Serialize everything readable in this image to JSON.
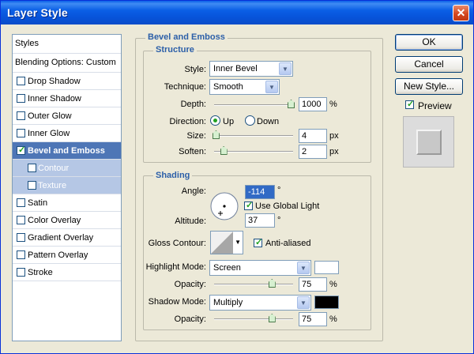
{
  "window": {
    "title": "Layer Style",
    "close_glyph": "✕"
  },
  "styles_list": {
    "header": "Styles",
    "blending": "Blending Options: Custom",
    "items": [
      {
        "label": "Drop Shadow",
        "checked": false
      },
      {
        "label": "Inner Shadow",
        "checked": false
      },
      {
        "label": "Outer Glow",
        "checked": false
      },
      {
        "label": "Inner Glow",
        "checked": false
      },
      {
        "label": "Bevel and Emboss",
        "checked": true,
        "selected": true
      },
      {
        "label": "Contour",
        "checked": false,
        "sub": true
      },
      {
        "label": "Texture",
        "checked": false,
        "sub": true
      },
      {
        "label": "Satin",
        "checked": false
      },
      {
        "label": "Color Overlay",
        "checked": false
      },
      {
        "label": "Gradient Overlay",
        "checked": false
      },
      {
        "label": "Pattern Overlay",
        "checked": false
      },
      {
        "label": "Stroke",
        "checked": false
      }
    ]
  },
  "bevel": {
    "section_title": "Bevel and Emboss",
    "structure_title": "Structure",
    "style_label": "Style:",
    "style_value": "Inner Bevel",
    "technique_label": "Technique:",
    "technique_value": "Smooth",
    "depth_label": "Depth:",
    "depth_value": "1000",
    "depth_unit": "%",
    "depth_level": 1.0,
    "direction_label": "Direction:",
    "direction_up": "Up",
    "direction_down": "Down",
    "direction_selected": "Up",
    "size_label": "Size:",
    "size_value": "4",
    "size_unit": "px",
    "size_level": 0.02,
    "soften_label": "Soften:",
    "soften_value": "2",
    "soften_unit": "px",
    "soften_level": 0.12
  },
  "shading": {
    "title": "Shading",
    "angle_label": "Angle:",
    "angle_value": "-114",
    "angle_unit": "°",
    "global_light_label": "Use Global Light",
    "global_light_checked": true,
    "altitude_label": "Altitude:",
    "altitude_value": "37",
    "altitude_unit": "°",
    "gloss_contour_label": "Gloss Contour:",
    "anti_aliased_label": "Anti-aliased",
    "anti_aliased_checked": true,
    "highlight_mode_label": "Highlight Mode:",
    "highlight_mode_value": "Screen",
    "highlight_color": "#ffffff",
    "highlight_opacity_label": "Opacity:",
    "highlight_opacity_value": "75",
    "highlight_opacity_unit": "%",
    "highlight_opacity_level": 0.75,
    "shadow_mode_label": "Shadow Mode:",
    "shadow_mode_value": "Multiply",
    "shadow_color": "#000000",
    "shadow_opacity_label": "Opacity:",
    "shadow_opacity_value": "75",
    "shadow_opacity_unit": "%",
    "shadow_opacity_level": 0.75
  },
  "actions": {
    "ok": "OK",
    "cancel": "Cancel",
    "new_style": "New Style...",
    "preview_label": "Preview",
    "preview_checked": true
  },
  "colors": {
    "accent": "#2c5fa8",
    "title_bar": "#0a5fe8",
    "selected_row": "#4e76b6"
  }
}
